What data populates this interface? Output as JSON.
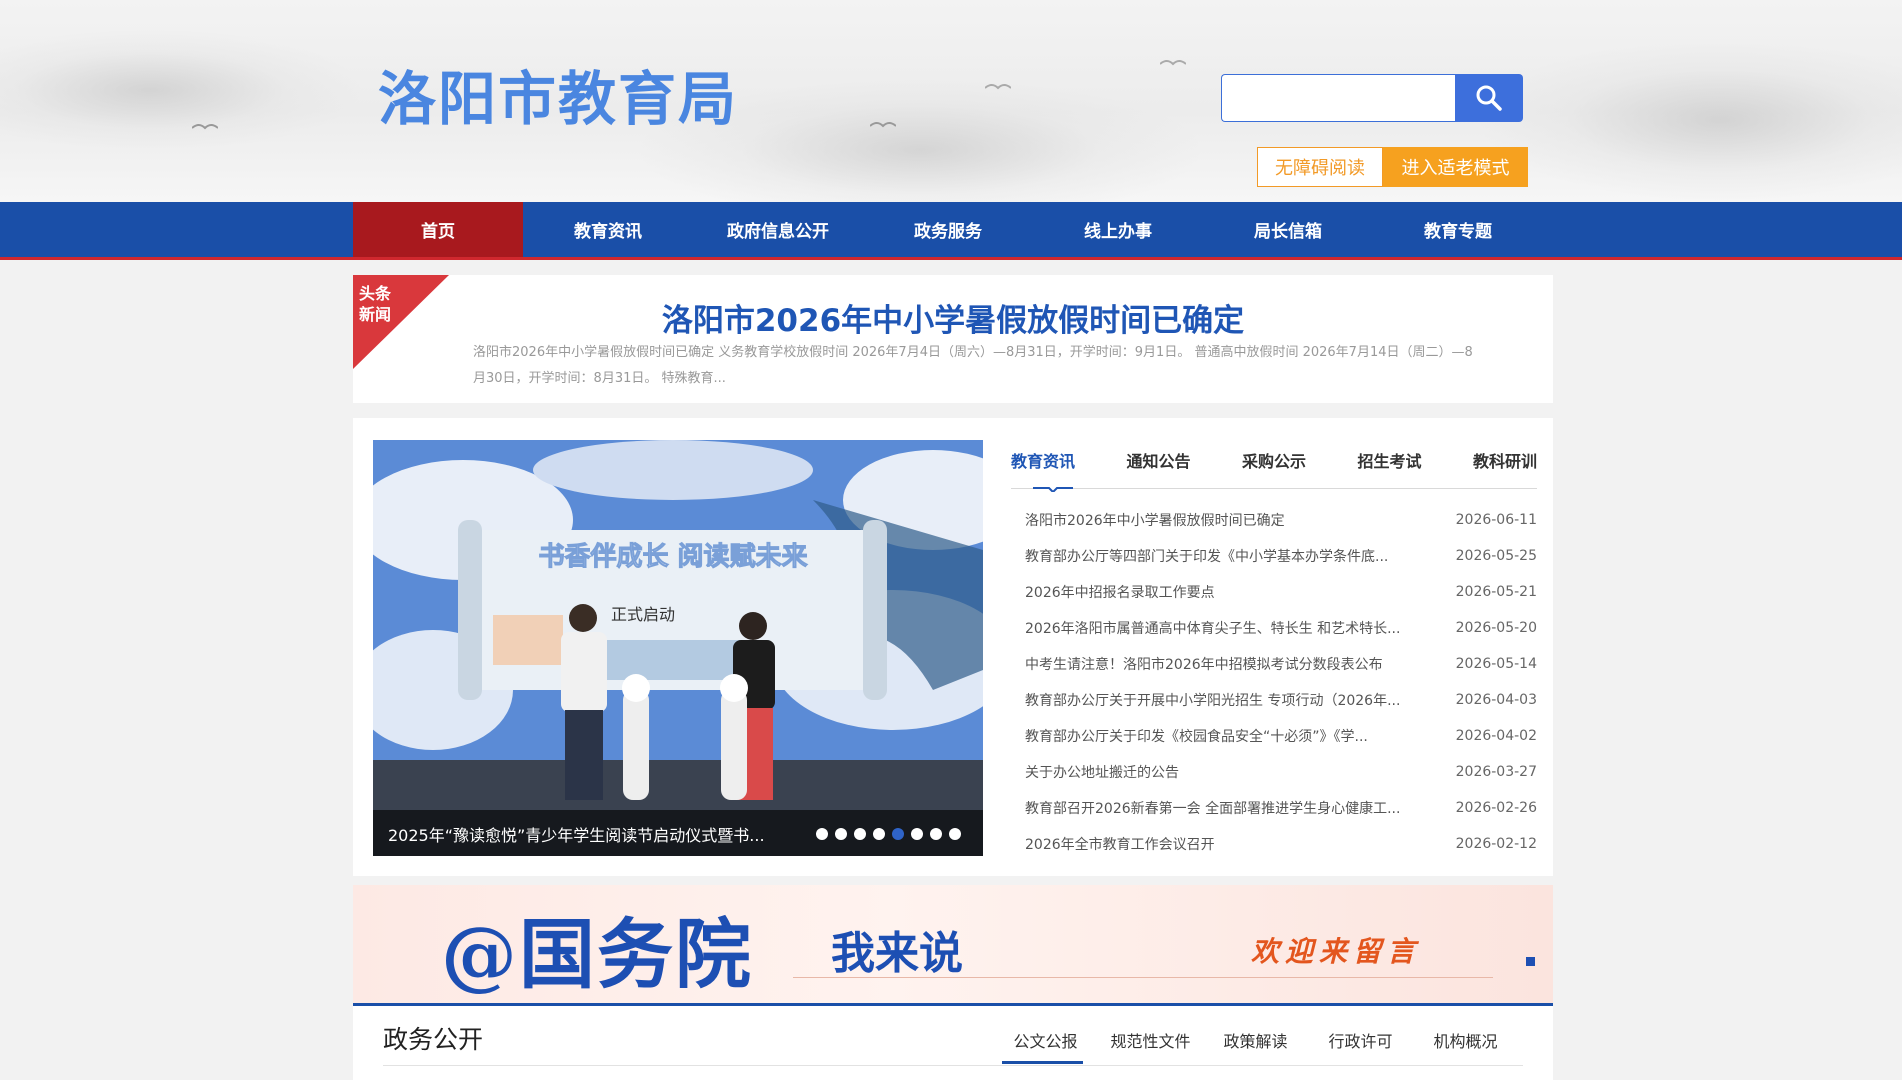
{
  "header": {
    "site_title": "洛阳市教育局",
    "search_placeholder": "",
    "accessibility_label": "无障碍阅读",
    "elder_mode_label": "进入适老模式"
  },
  "nav": {
    "items": [
      "首页",
      "教育资讯",
      "政府信息公开",
      "政务服务",
      "线上办事",
      "局长信箱",
      "教育专题"
    ],
    "active_index": 0
  },
  "headline": {
    "badge": "头条新闻",
    "title": "洛阳市2026年中小学暑假放假时间已确定",
    "summary": "洛阳市2026年中小学暑假放假时间已确定 义务教育学校放假时间 2026年7月4日（周六）—8月31日，开学时间：9月1日。 普通高中放假时间 2026年7月14日（周二）—8月30日，开学时间：8月31日。 特殊教育..."
  },
  "carousel": {
    "scroll_title": "书香伴成长 阅读赋未来",
    "scroll_sub": "正式启动",
    "caption": "2025年“豫读愈悦”青少年学生阅读节启动仪式暨书...",
    "dot_count": 8,
    "active_dot": 4
  },
  "news_tabs": [
    "教育资讯",
    "通知公告",
    "采购公示",
    "招生考试",
    "教科研训"
  ],
  "news_items": [
    {
      "title": "洛阳市2026年中小学暑假放假时间已确定",
      "date": "2026-06-11"
    },
    {
      "title": "教育部办公厅等四部门关于印发《中小学基本办学条件底...",
      "date": "2026-05-25"
    },
    {
      "title": "2026年中招报名录取工作要点",
      "date": "2026-05-21"
    },
    {
      "title": "2026年洛阳市属普通高中体育尖子生、特长生 和艺术特长...",
      "date": "2026-05-20"
    },
    {
      "title": "中考生请注意！洛阳市2026年中招模拟考试分数段表公布",
      "date": "2026-05-14"
    },
    {
      "title": "教育部办公厅关于开展中小学阳光招生 专项行动（2026年...",
      "date": "2026-04-03"
    },
    {
      "title": "教育部办公厅关于印发《校园食品安全“十必须”》《学...",
      "date": "2026-04-02"
    },
    {
      "title": "关于办公地址搬迁的公告",
      "date": "2026-03-27"
    },
    {
      "title": "教育部召开2026新春第一会 全面部署推进学生身心健康工...",
      "date": "2026-02-26"
    },
    {
      "title": "2026年全市教育工作会议召开",
      "date": "2026-02-12"
    }
  ],
  "banner": {
    "main": "@国务院",
    "say": "我来说",
    "welcome": "欢迎来留言"
  },
  "gov": {
    "title": "政务公开",
    "tabs": [
      "公文公报",
      "规范性文件",
      "政策解读",
      "行政许可",
      "机构概况"
    ]
  },
  "colors": {
    "nav_blue": "#1a4fa8",
    "nav_active_red": "#a8191e",
    "title_blue": "#4a86e0",
    "orange": "#f6a11f"
  }
}
